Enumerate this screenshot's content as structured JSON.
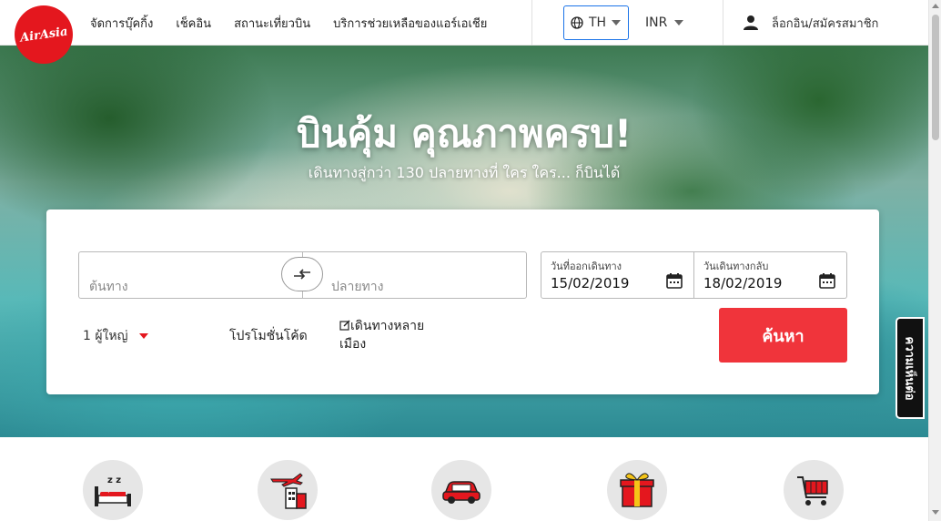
{
  "header": {
    "logo_text": "AirAsia",
    "nav": [
      "จัดการบุ๊คกิ้ง",
      "เช็คอิน",
      "สถานะเที่ยวบิน",
      "บริการช่วยเหลือของแอร์เอเชีย"
    ],
    "language": "TH",
    "currency": "INR",
    "login_label": "ล็อกอิน/สมัครสมาชิก"
  },
  "hero": {
    "title": "บินคุ้ม คุณภาพครบ!",
    "subtitle": "เดินทางสู่กว่า 130 ปลายทางที่ ใคร ใคร... ก็บินได้"
  },
  "search": {
    "origin_placeholder": "ต้นทาง",
    "destination_placeholder": "ปลายทาง",
    "depart_label": "วันที่ออกเดินทาง",
    "depart_value": "15/02/2019",
    "return_label": "วันเดินทางกลับ",
    "return_value": "18/02/2019",
    "passengers": "1 ผู้ใหญ่",
    "promo_label": "โปรโมชั่นโค้ด",
    "multi_city_label": "เดินทางหลายเมือง",
    "search_button": "ค้นหา"
  },
  "feedback_label": "ความเห็นต่อ",
  "services": [
    "hotel-icon",
    "flight-hotel-icon",
    "car-icon",
    "gift-icon",
    "shopping-cart-icon"
  ],
  "colors": {
    "brand": "#e4171e",
    "search_button": "#f0343b",
    "lang_border": "#1a73e8"
  }
}
